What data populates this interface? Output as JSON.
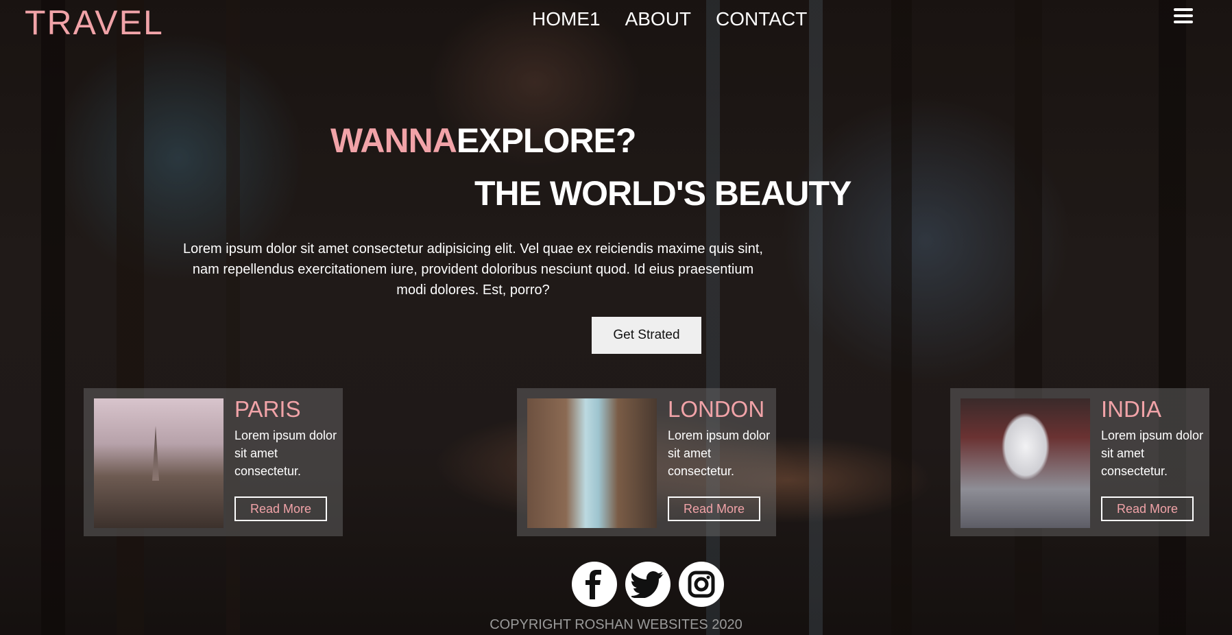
{
  "header": {
    "logo": "TRAVEL",
    "nav": [
      "HOME1",
      "ABOUT",
      "CONTACT"
    ],
    "menu_icon": "hamburger-menu-icon"
  },
  "hero": {
    "line1_accent": "WANNA",
    "line1_rest": "EXPLORE?",
    "line2": "THE WORLD'S BEAUTY",
    "lead": "Lorem ipsum dolor sit amet consectetur adipisicing elit. Vel quae ex reiciendis maxime quis sint, nam repellendus exercitationem iure, provident doloribus nesciunt quod. Id eius praesentium modi dolores. Est, porro?",
    "cta": "Get Strated"
  },
  "cards": [
    {
      "title": "PARIS",
      "desc": "Lorem ipsum dolor sit amet consectetur.",
      "button": "Read More"
    },
    {
      "title": "LONDON",
      "desc": "Lorem ipsum dolor sit amet consectetur.",
      "button": "Read More"
    },
    {
      "title": "INDIA",
      "desc": "Lorem ipsum dolor sit amet consectetur.",
      "button": "Read More"
    }
  ],
  "social": [
    "facebook-icon",
    "twitter-icon",
    "instagram-icon"
  ],
  "footer": {
    "copyright": "COPYRIGHT ROSHAN WEBSITES 2020"
  },
  "colors": {
    "accent": "#f1a3a8",
    "button_bg": "#efefef",
    "card_bg": "#6e6e6e"
  }
}
